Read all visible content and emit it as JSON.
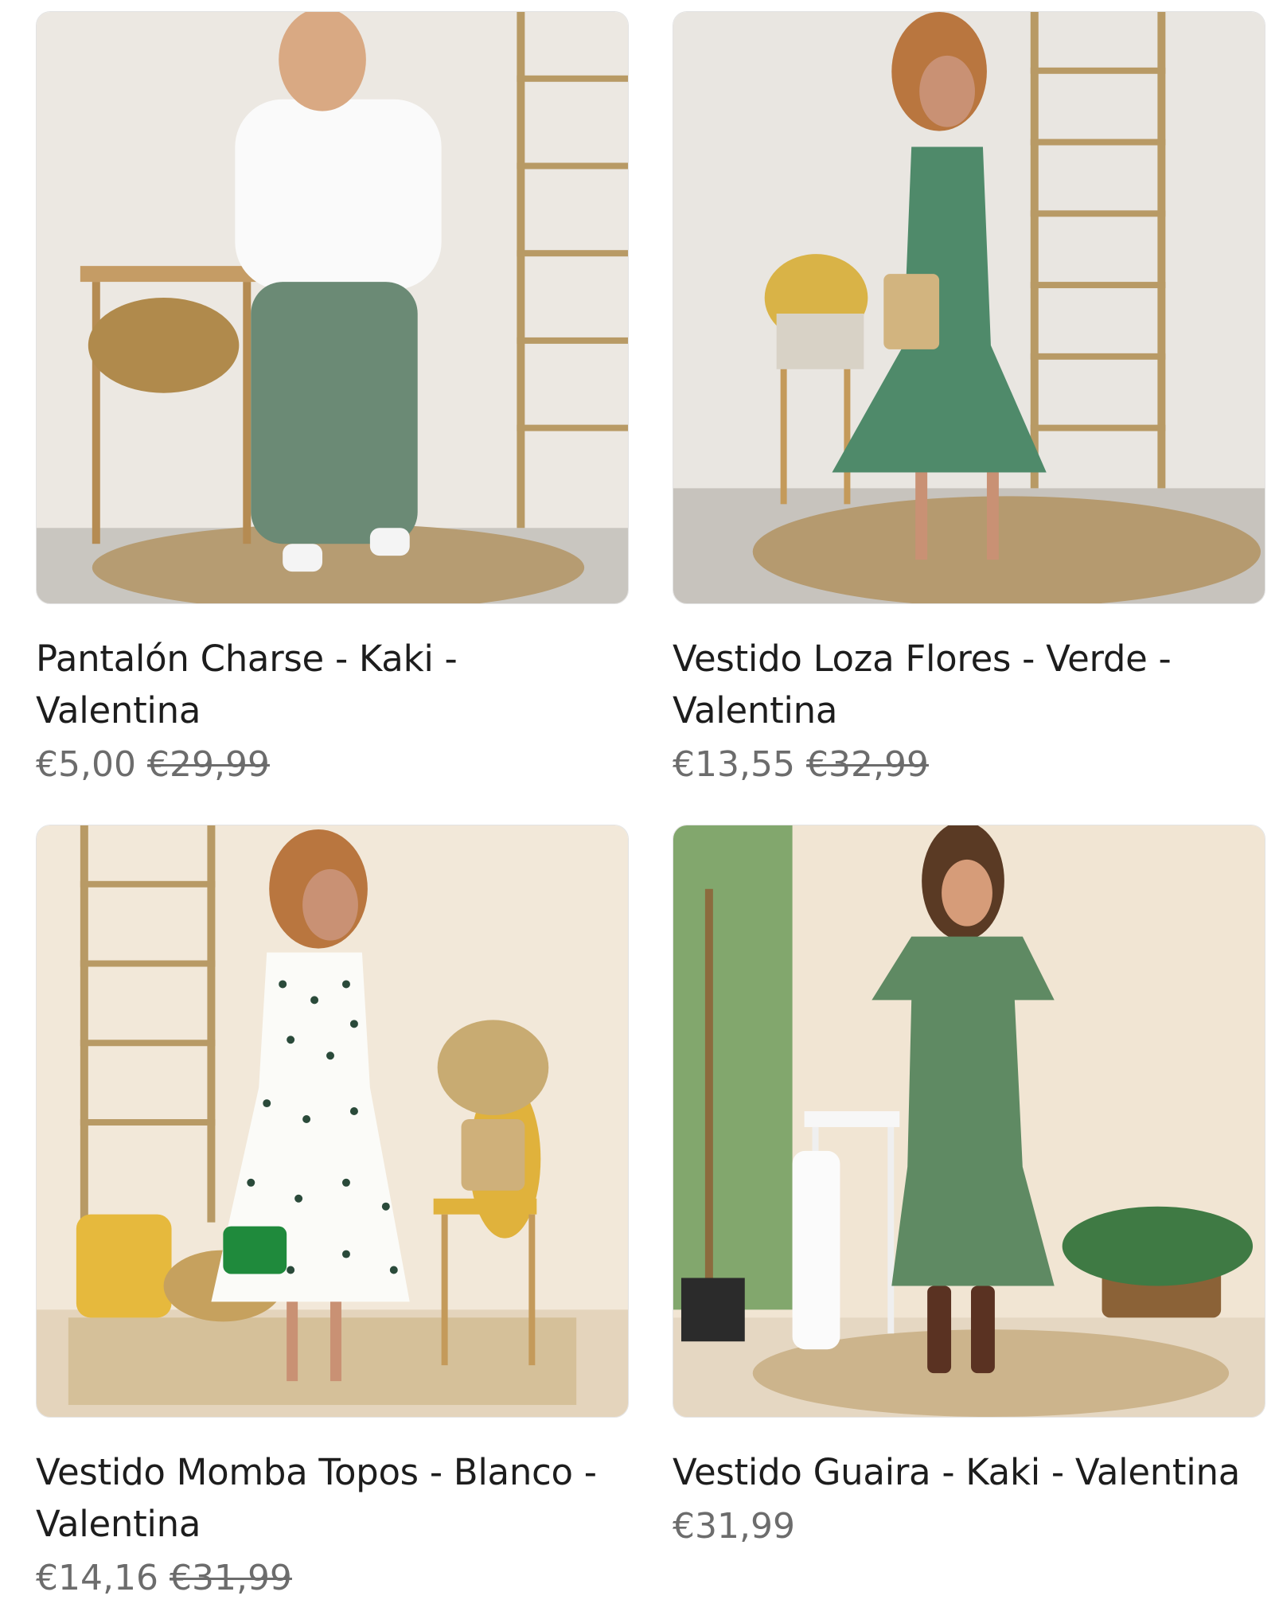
{
  "products": [
    {
      "title": "Pantalón Charse - Kaki - Valentina",
      "price": "€5,00",
      "old_price": "€29,99",
      "image_alt": "photo-model-white-top-green-trousers"
    },
    {
      "title": "Vestido Loza Flores - Verde - Valentina",
      "price": "€13,55",
      "old_price": "€32,99",
      "image_alt": "photo-model-green-floral-dress"
    },
    {
      "title": "Vestido Momba Topos - Blanco - Valentina",
      "price": "€14,16",
      "old_price": "€31,99",
      "image_alt": "photo-model-white-polka-dot-dress"
    },
    {
      "title": "Vestido Guaira - Kaki - Valentina",
      "price": "€31,99",
      "old_price": "",
      "image_alt": "photo-model-khaki-ruffle-dress"
    }
  ],
  "colors": {
    "text": "#1d1d1d",
    "price": "#6c6c6c",
    "border": "#e3e3e3"
  }
}
